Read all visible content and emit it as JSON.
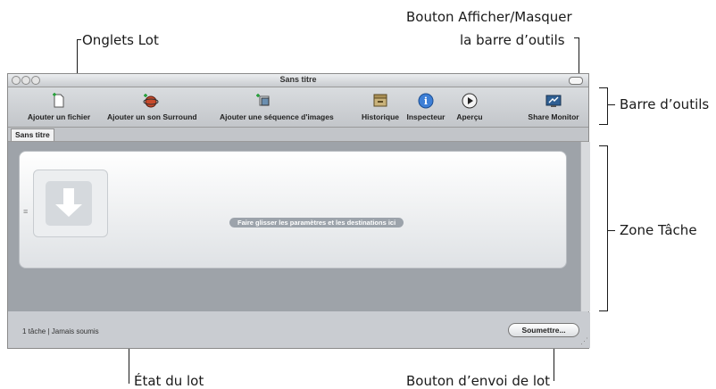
{
  "window": {
    "title": "Sans titre",
    "tab_label": "Sans titre"
  },
  "toolbar": {
    "items": [
      {
        "label": "Ajouter un fichier",
        "icon": "add-file-icon"
      },
      {
        "label": "Ajouter un son Surround",
        "icon": "surround-icon"
      },
      {
        "label": "Ajouter une séquence d'images",
        "icon": "image-sequence-icon"
      },
      {
        "label": "Historique",
        "icon": "history-icon"
      },
      {
        "label": "Inspecteur",
        "icon": "info-icon"
      },
      {
        "label": "Aperçu",
        "icon": "play-icon"
      },
      {
        "label": "Share Monitor",
        "icon": "share-monitor-icon"
      }
    ]
  },
  "job_area": {
    "drop_hint": "Faire glisser les paramètres et les destinations ici"
  },
  "status": {
    "text": "1 tâche  |  Jamais soumis",
    "submit_label": "Soumettre..."
  },
  "callouts": {
    "batch_tabs": "Onglets Lot",
    "toolbar_button_line1": "Bouton Afficher/Masquer",
    "toolbar_button_line2": "la barre d’outils",
    "toolbar": "Barre d’outils",
    "job_area": "Zone Tâche",
    "batch_status": "État du lot",
    "submit_button": "Bouton d’envoi de lot"
  },
  "colors": {
    "info_blue": "#3d7fd6",
    "surround_red": "#c94a2b",
    "job_area_bg": "#9ea3a9"
  }
}
